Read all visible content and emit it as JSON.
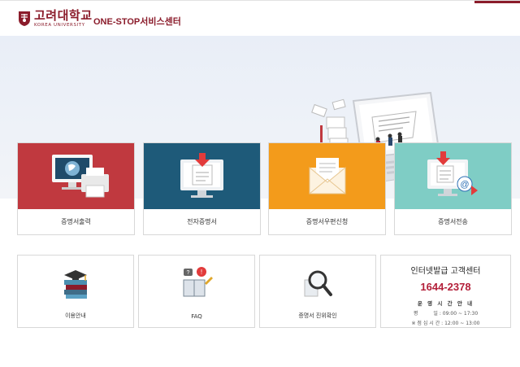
{
  "header": {
    "logo_ko": "고려대학교",
    "logo_en": "KOREA UNIVERSITY",
    "service_title": "ONE-STOP서비스센터",
    "brand_color": "#8b1c2b"
  },
  "cards": [
    {
      "label": "증명서출력",
      "color": "#c0393f",
      "icon": "computer-printer-icon"
    },
    {
      "label": "전자증명서",
      "color": "#1e5a79",
      "icon": "monitor-download-icon"
    },
    {
      "label": "증명서우편신청",
      "color": "#f39b1b",
      "icon": "envelope-icon"
    },
    {
      "label": "증명서전송",
      "color": "#7fcdc5",
      "icon": "monitor-email-icon"
    }
  ],
  "quick_links": [
    {
      "label": "이용안내",
      "icon": "books-graduation-cap-icon"
    },
    {
      "label": "FAQ",
      "icon": "faq-book-icon"
    },
    {
      "label": "증명서 진위확인",
      "icon": "magnifier-icon"
    }
  ],
  "help_center": {
    "title": "인터넷발급 고객센터",
    "phone": "1644-2378",
    "hours_title": "운 영 시 간 안 내",
    "weekday_line": "평          일 : 09:00 ~ 17:30",
    "lunch_line": "※ 점 심 시 간 : 12:00 ~ 13:00"
  }
}
